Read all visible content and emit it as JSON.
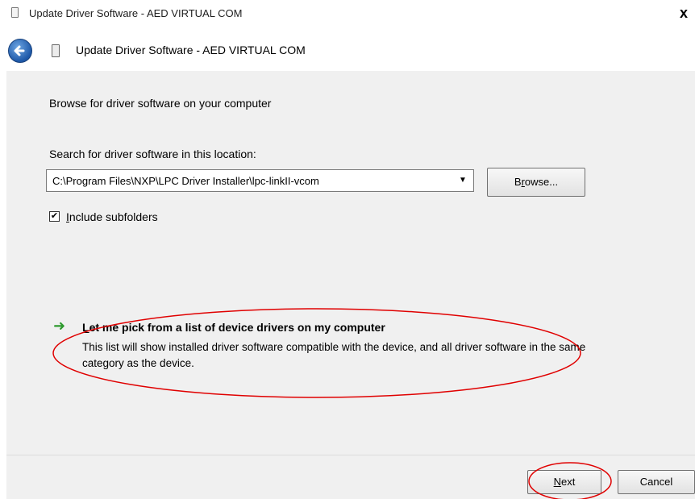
{
  "window": {
    "title": "Update Driver Software - AED VIRTUAL COM",
    "close_glyph": "x"
  },
  "nav": {
    "title": "Update Driver Software - AED VIRTUAL COM"
  },
  "content": {
    "heading": "Browse for driver software on your computer",
    "search_label": "Search for driver software in this location:",
    "path_value": "C:\\Program Files\\NXP\\LPC Driver Installer\\lpc-linkII-vcom",
    "browse_label": "Browse...",
    "include_subfolders_label": "Include subfolders",
    "include_subfolders_checked": true,
    "pick_title": "Let me pick from a list of device drivers on my computer",
    "pick_description": "This list will show installed driver software compatible with the device, and all driver software in the same category as the device."
  },
  "footer": {
    "next_label": "Next",
    "cancel_label": "Cancel"
  },
  "annotations": {
    "highlight_color": "#e00000"
  },
  "icons": {
    "back": "back-arrow-icon",
    "window": "device-icon",
    "pick": "green-arrow-icon"
  }
}
